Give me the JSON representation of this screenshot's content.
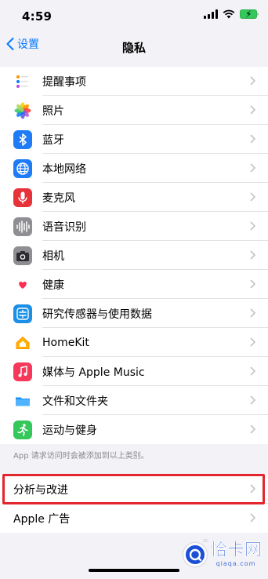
{
  "status_bar": {
    "time": "4:59"
  },
  "nav": {
    "back_label": "设置",
    "title": "隐私"
  },
  "items": [
    {
      "label": "提醒事项",
      "icon": "reminders-icon",
      "color": "#ffffff"
    },
    {
      "label": "照片",
      "icon": "photos-icon",
      "color": "#ffffff"
    },
    {
      "label": "蓝牙",
      "icon": "bluetooth-icon",
      "color": "#1f7cf6"
    },
    {
      "label": "本地网络",
      "icon": "globe-icon",
      "color": "#1f7cf6"
    },
    {
      "label": "麦克风",
      "icon": "microphone-icon",
      "color": "#e8323a"
    },
    {
      "label": "语音识别",
      "icon": "waveform-icon",
      "color": "#8e8e93"
    },
    {
      "label": "相机",
      "icon": "camera-icon",
      "color": "#8e8e93"
    },
    {
      "label": "健康",
      "icon": "heart-icon",
      "color": "#ffffff"
    },
    {
      "label": "研究传感器与使用数据",
      "icon": "research-icon",
      "color": "#1c8fe6"
    },
    {
      "label": "HomeKit",
      "icon": "home-icon",
      "color": "#ffffff"
    },
    {
      "label": "媒体与 Apple Music",
      "icon": "music-icon",
      "color": "#f6395b"
    },
    {
      "label": "文件和文件夹",
      "icon": "folder-icon",
      "color": "#ffffff"
    },
    {
      "label": "运动与健身",
      "icon": "fitness-icon",
      "color": "#34c759"
    }
  ],
  "footer_note": "App 请求访问时会被添加到以上类别。",
  "group2": [
    {
      "label": "分析与改进"
    },
    {
      "label": "Apple 广告"
    }
  ],
  "watermark": {
    "title": "恰卡网",
    "sub": "qiaqa.com"
  },
  "colors": {
    "accent": "#0a7aff",
    "highlight": "#e3262e"
  }
}
